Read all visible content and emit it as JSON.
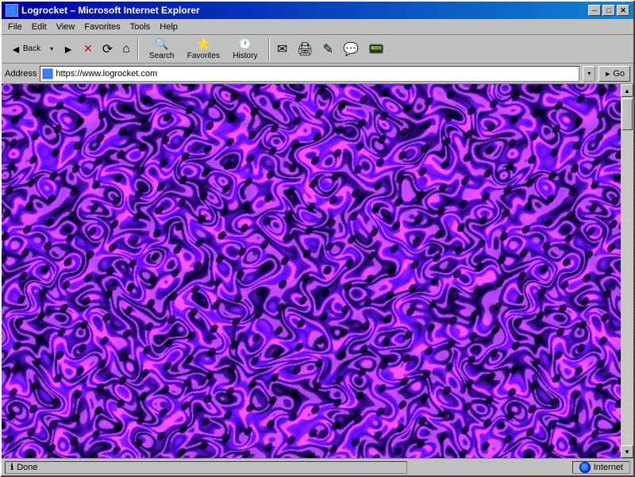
{
  "window": {
    "title": "Logrocket – Microsoft Internet Explorer",
    "icon": "🌐"
  },
  "titlebar": {
    "minimize_label": "─",
    "maximize_label": "□",
    "close_label": "✕"
  },
  "menu": {
    "items": [
      "File",
      "Edit",
      "View",
      "Favorites",
      "Tools",
      "Help"
    ]
  },
  "toolbar": {
    "back_label": "Back",
    "back_arrow": "▾",
    "forward_label": "►",
    "stop_label": "✕",
    "refresh_label": "⟳",
    "home_label": "⌂",
    "search_label": "Search",
    "favorites_label": "Favorites",
    "history_label": "History",
    "mail_label": "✉",
    "print_label": "🖨",
    "edit_label": "✎",
    "discuss_label": "💬",
    "messenger_label": "📟"
  },
  "address_bar": {
    "label": "Address",
    "url": "https://www.logrocket.com",
    "go_label": "Go",
    "go_arrow": "►",
    "dropdown_arrow": "▾"
  },
  "scrollbar": {
    "up_arrow": "▲",
    "down_arrow": "▼"
  },
  "status": {
    "text": "Done",
    "zone": "Internet"
  }
}
